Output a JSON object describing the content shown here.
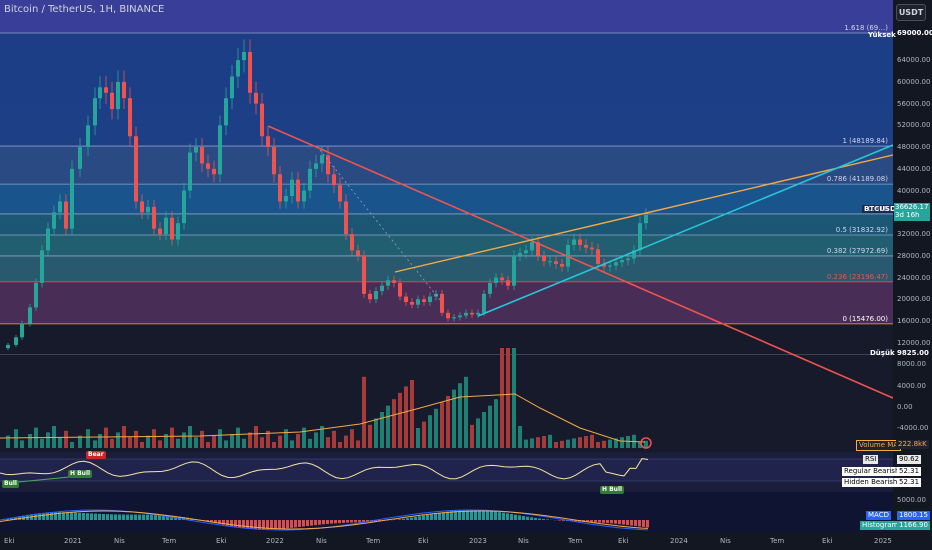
{
  "header": {
    "title": "Bitcoin / TetherUS, 1H, BINANCE",
    "currency": "USDT"
  },
  "price_axis": [
    "69000.00",
    "64000.00",
    "60000.00",
    "56000.00",
    "52000.00",
    "48000.00",
    "44000.00",
    "40000.00",
    "36000.00",
    "32000.00",
    "28000.00",
    "24000.00",
    "20000.00",
    "16000.00",
    "12000.00",
    "8000.00",
    "4000.00",
    "0.00",
    "-4000.00"
  ],
  "markers": {
    "high_label": "Yüksek",
    "high_value": "69000.00",
    "low_label": "Düşük",
    "low_value": "9825.00",
    "symbol_tag": "BTCUSDT",
    "symbol_price": "36626.17",
    "symbol_countdown": "3d 16h"
  },
  "fib_levels": [
    {
      "label": "1.618 (69…)",
      "value": 69000
    },
    {
      "label": "1 (48189.84)",
      "value": 48189.84
    },
    {
      "label": "0.786 (41189.08)",
      "value": 41189.08
    },
    {
      "label": "0.618",
      "value": 35700
    },
    {
      "label": "0.5 (31832.92)",
      "value": 31832.92
    },
    {
      "label": "0.382 (27972.69)",
      "value": 27972.69
    },
    {
      "label": "0.236 (23196.47)",
      "value": 23196.47
    },
    {
      "label": "0 (15476.00)",
      "value": 15476.0
    }
  ],
  "volume_panel": {
    "label": "Volume MA",
    "value": "222.8kK"
  },
  "rsi_panel": {
    "rsi_label": "RSI",
    "rsi_value": "90.62",
    "regular_bearish_label": "Regular Bearish",
    "regular_bearish_value": "52.31",
    "hidden_bearish_label": "Hidden Bearish",
    "hidden_bearish_value": "52.31",
    "badge_bull": "Bull",
    "badge_hbull_1": "H Bull",
    "badge_hbull_2": "H Bull",
    "badge_bear": "Bear"
  },
  "macd_panel": {
    "axis_value": "5000.00",
    "macd_label": "MACD",
    "macd_value": "1800.15",
    "histogram_label": "Histogram",
    "histogram_value": "1166.90"
  },
  "time_axis": [
    "Eki",
    "2021",
    "Nis",
    "Tem",
    "Eki",
    "2022",
    "Nis",
    "Tem",
    "Eki",
    "2023",
    "Nis",
    "Tem",
    "Eki",
    "2024",
    "Nis",
    "Tem",
    "Eki",
    "2025"
  ],
  "colors": {
    "up": "#26a69a",
    "down": "#ef5350",
    "trend_orange": "#f7a942",
    "trend_teal": "#26c6da",
    "trend_red": "#f05350"
  },
  "chart_data": {
    "type": "candlestick",
    "title": "Bitcoin / TetherUS, 1H, BINANCE",
    "x": [
      "Eki 2020",
      "2021",
      "Nis 2021",
      "Tem 2021",
      "Eki 2021",
      "2022",
      "Nis 2022",
      "Tem 2022",
      "Eki 2022",
      "2023",
      "Nis 2023",
      "Tem 2023",
      "Eki 2023"
    ],
    "close": [
      11500,
      29000,
      58000,
      35000,
      61000,
      46000,
      45000,
      20500,
      19500,
      16500,
      28500,
      29200,
      35500
    ],
    "ylim": [
      -4000,
      72000
    ],
    "last_price": 36626.17
  }
}
